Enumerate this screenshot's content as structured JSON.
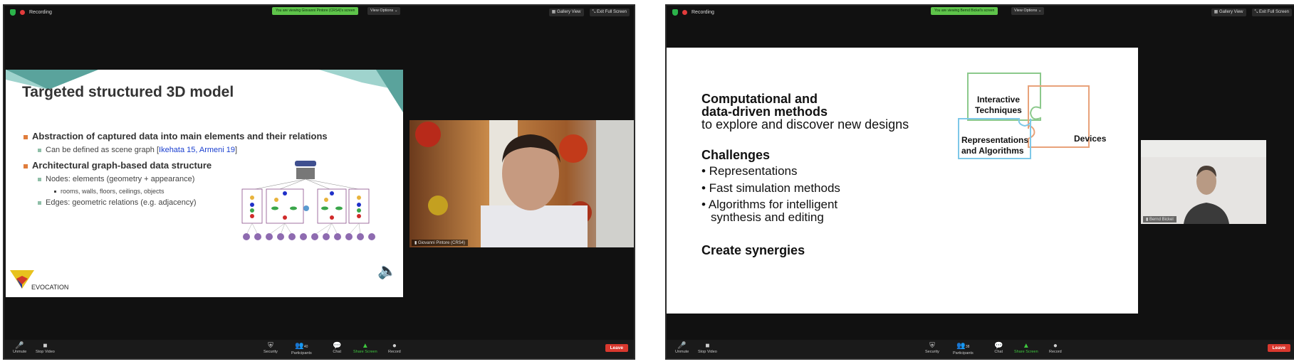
{
  "left": {
    "recording": "Recording",
    "viewing_banner": "You are viewing Giovanni Pintore (CRS4)'s screen",
    "view_options": "View Options ⌄",
    "gallery_view": "Gallery View",
    "exit_full_screen": "Exit Full Screen",
    "slide": {
      "title": "Targeted structured 3D model",
      "b1": "Abstraction of captured data into main elements and their relations",
      "b1_sub_prefix": "Can be defined as scene graph [",
      "b1_sub_cite": "Ikehata 15, Armeni 19",
      "b1_sub_suffix": "]",
      "b2": "Architectural graph-based data structure",
      "b2_sub1": "Nodes: elements (geometry + appearance)",
      "b2_sub1_detail": "rooms, walls, floors, ceilings, objects",
      "b2_sub2": "Edges: geometric relations (e.g. adjacency)",
      "logo_text": "EVOCATION"
    },
    "speaker_name": "Giovanni Pintore (CRS4)",
    "toolbar": {
      "unmute": "Unmute",
      "stop_video": "Stop Video",
      "security": "Security",
      "participants": "Participants",
      "participants_count": "40",
      "chat": "Chat",
      "share_screen": "Share Screen",
      "record": "Record",
      "leave": "Leave"
    }
  },
  "right": {
    "recording": "Recording",
    "viewing_banner": "You are viewing Bernd Bickel's screen",
    "view_options": "View Options ⌄",
    "gallery_view": "Gallery View",
    "exit_full_screen": "Exit Full Screen",
    "slide": {
      "h1a": "Computational and",
      "h1b": "data-driven methods",
      "h1c": "to explore and discover new designs",
      "challenges": "Challenges",
      "c1": "• Representations",
      "c2": "• Fast simulation methods",
      "c3a": "• Algorithms for intelligent",
      "c3b": "synthesis and editing",
      "create": "Create synergies",
      "p1a": "Interactive",
      "p1b": "Techniques",
      "p2": "Devices",
      "p3a": "Representations",
      "p3b": "and Algorithms"
    },
    "speaker_name": "Bernd Bickel",
    "toolbar": {
      "unmute": "Unmute",
      "stop_video": "Stop Video",
      "security": "Security",
      "participants": "Participants",
      "participants_count": "38",
      "chat": "Chat",
      "share_screen": "Share Screen",
      "record": "Record",
      "leave": "Leave"
    }
  },
  "colors": {
    "accent_green": "#5ec44a",
    "leave_red": "#d9382e",
    "bullet_orange": "#e07d3c",
    "puzzle_green": "#8cc98c",
    "puzzle_orange": "#e8a27a",
    "puzzle_blue": "#7ec8e8"
  }
}
